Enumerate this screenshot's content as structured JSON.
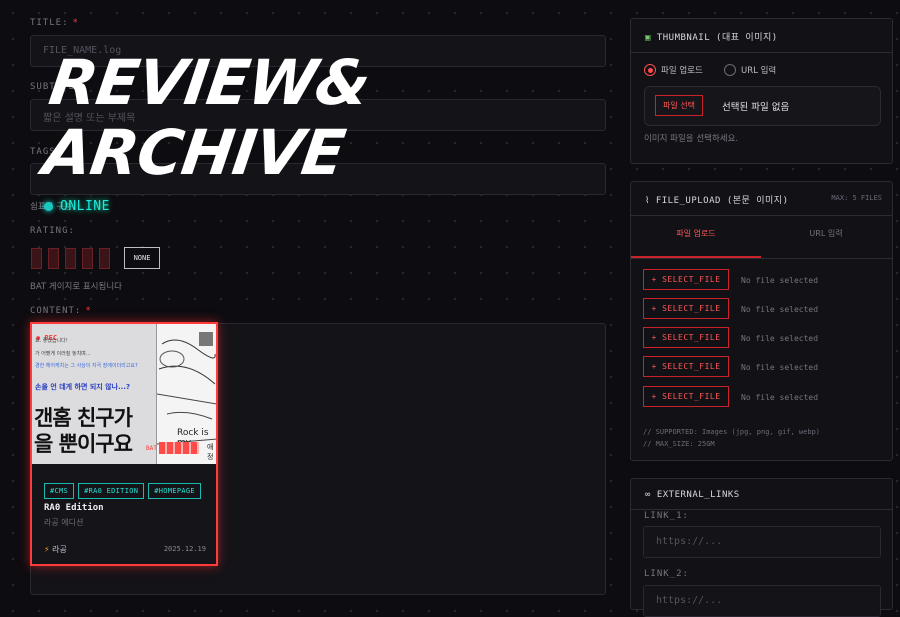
{
  "form": {
    "title_label": "TITLE:",
    "title_placeholder": "FILE_NAME.log",
    "subtitle_label": "SUBTITLE:",
    "subtitle_placeholder": "짧은 설명 또는 부제목",
    "tags_label": "TAGS:",
    "tags_hint": "쉼표로 구분",
    "rating_label": "RATING:",
    "rating_none": "NONE",
    "rating_hint": "BAT 게이지로 표시됩니다",
    "content_label": "CONTENT:",
    "required": "*"
  },
  "overlay": {
    "line1": "REVIEW&",
    "line2": "ARCHIVE",
    "status": "ONLINE",
    "status_color": "#1ee8de"
  },
  "card": {
    "rec": "REC",
    "bat": "BAT",
    "speech": [
      "요. 좋겠습니다!",
      "가 어쨌게 이러질 놓치며...",
      "경한 헤어캐치는 그 사상이 지극 장애이더리고요?"
    ],
    "blue_line": "손을 언 데게 하면 되지 않나...?",
    "headline1": "갠홈 친구가",
    "headline2": "을 뿐이구요",
    "manga_text": "Rock is my",
    "manga_side": "애정",
    "tags": [
      "#CMS",
      "#RA0 EDITION",
      "#HOMEPAGE"
    ],
    "title": "RA0 Edition",
    "subtitle": "라공 에디션",
    "author": "라공",
    "date": "2025.12.19",
    "accent": "#ff3b3b"
  },
  "thumbnail": {
    "title": "THUMBNAIL (대표 이미지)",
    "opt_upload": "파일 업로드",
    "opt_url": "URL 입력",
    "choose": "파일 선택",
    "none_selected": "선택된 파일 없음",
    "hint": "이미지 파일을 선택하세요."
  },
  "file_upload": {
    "title": "FILE_UPLOAD (본문 이미지)",
    "max": "MAX: 5 FILES",
    "tab_upload": "파일 업로드",
    "tab_url": "URL 입력",
    "rows": [
      {
        "button": "+ SELECT_FILE",
        "status": "No file selected"
      },
      {
        "button": "+ SELECT_FILE",
        "status": "No file selected"
      },
      {
        "button": "+ SELECT_FILE",
        "status": "No file selected"
      },
      {
        "button": "+ SELECT_FILE",
        "status": "No file selected"
      },
      {
        "button": "+ SELECT_FILE",
        "status": "No file selected"
      }
    ],
    "supported": "// SUPPORTED: Images (jpg, png, gif, webp)",
    "max_size": "// MAX_SIZE: 25GM"
  },
  "external_links": {
    "title": "EXTERNAL_LINKS",
    "link1_label": "LINK_1:",
    "link1_placeholder": "https://...",
    "link2_label": "LINK_2:",
    "link2_placeholder": "https://..."
  }
}
